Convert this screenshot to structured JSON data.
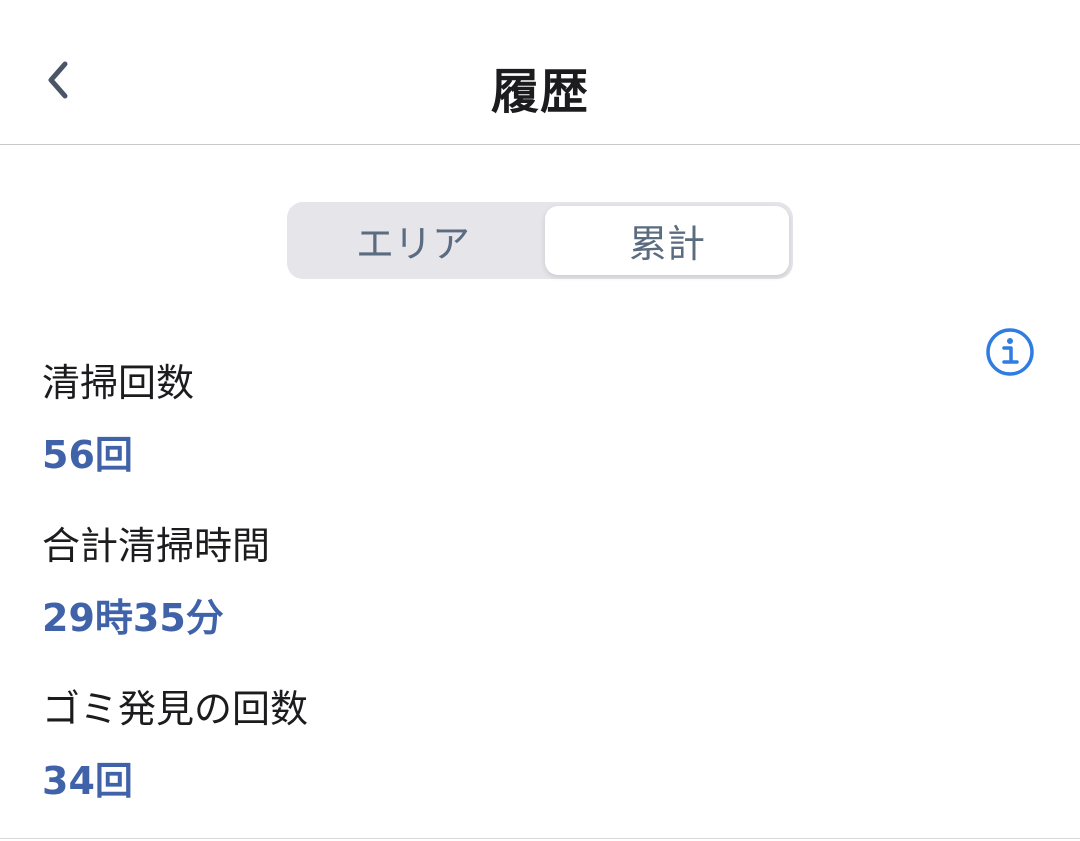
{
  "header": {
    "title": "履歴",
    "back_icon": "chevron-left-icon"
  },
  "tabs": [
    {
      "label": "エリア",
      "selected": false
    },
    {
      "label": "累計",
      "selected": true
    }
  ],
  "info_icon": "info-circle-icon",
  "stats": [
    {
      "label": "清掃回数",
      "value": "56回"
    },
    {
      "label": "合計清掃時間",
      "value": "29時35分"
    },
    {
      "label": "ゴミ発見の回数",
      "value": "34回"
    }
  ],
  "colors": {
    "accent": "#3f62a8",
    "info_icon": "#2f7de1",
    "segment_background": "#e5e5ea",
    "segment_text": "#5b6b80"
  }
}
